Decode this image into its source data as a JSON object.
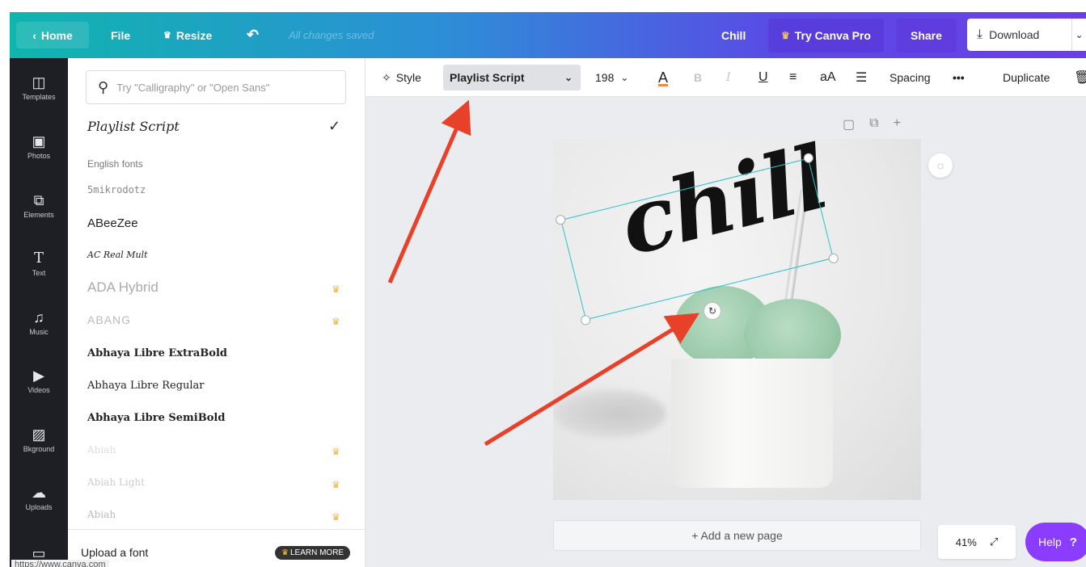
{
  "topbar": {
    "home": "Home",
    "file": "File",
    "resize": "Resize",
    "saved_status": "All changes saved",
    "design_title": "Chill",
    "try_pro": "Try Canva Pro",
    "share": "Share",
    "download": "Download"
  },
  "rail": [
    {
      "label": "Templates",
      "icon": "templates-icon"
    },
    {
      "label": "Photos",
      "icon": "photos-icon"
    },
    {
      "label": "Elements",
      "icon": "elements-icon"
    },
    {
      "label": "Text",
      "icon": "text-icon"
    },
    {
      "label": "Music",
      "icon": "music-icon"
    },
    {
      "label": "Videos",
      "icon": "videos-icon"
    },
    {
      "label": "Bkground",
      "icon": "background-icon"
    },
    {
      "label": "Uploads",
      "icon": "uploads-icon"
    },
    {
      "label": "",
      "icon": "folder-icon"
    }
  ],
  "font_panel": {
    "search_placeholder": "Try \"Calligraphy\" or \"Open Sans\"",
    "current_font": "Playlist Script",
    "section": "English fonts",
    "fonts": [
      {
        "name": "5mikrodotz",
        "pro": false
      },
      {
        "name": "ABeeZee",
        "pro": false
      },
      {
        "name": "AC Real Mult",
        "pro": false
      },
      {
        "name": "ADA Hybrid",
        "pro": true
      },
      {
        "name": "ABANG",
        "pro": true
      },
      {
        "name": "Abhaya Libre ExtraBold",
        "pro": false
      },
      {
        "name": "Abhaya Libre Regular",
        "pro": false
      },
      {
        "name": "Abhaya Libre SemiBold",
        "pro": false
      },
      {
        "name": "Abiah",
        "pro": true
      },
      {
        "name": "Abiah Light",
        "pro": true
      },
      {
        "name": "Abiah",
        "pro": true
      }
    ],
    "upload_label": "Upload a font",
    "learn_more": "LEARN MORE",
    "status_url": "https://www.canva.com"
  },
  "toolbar": {
    "style": "Style",
    "font": "Playlist Script",
    "size": "198",
    "spacing": "Spacing",
    "more": "•••",
    "duplicate": "Duplicate"
  },
  "canvas": {
    "text": "chill",
    "add_page": "+ Add a new page",
    "zoom": "41%",
    "help": "Help",
    "help_mark": "?"
  },
  "colors": {
    "selection": "#27c3c9",
    "arrow": "#e8412a",
    "help_bg": "#8b3dff"
  }
}
